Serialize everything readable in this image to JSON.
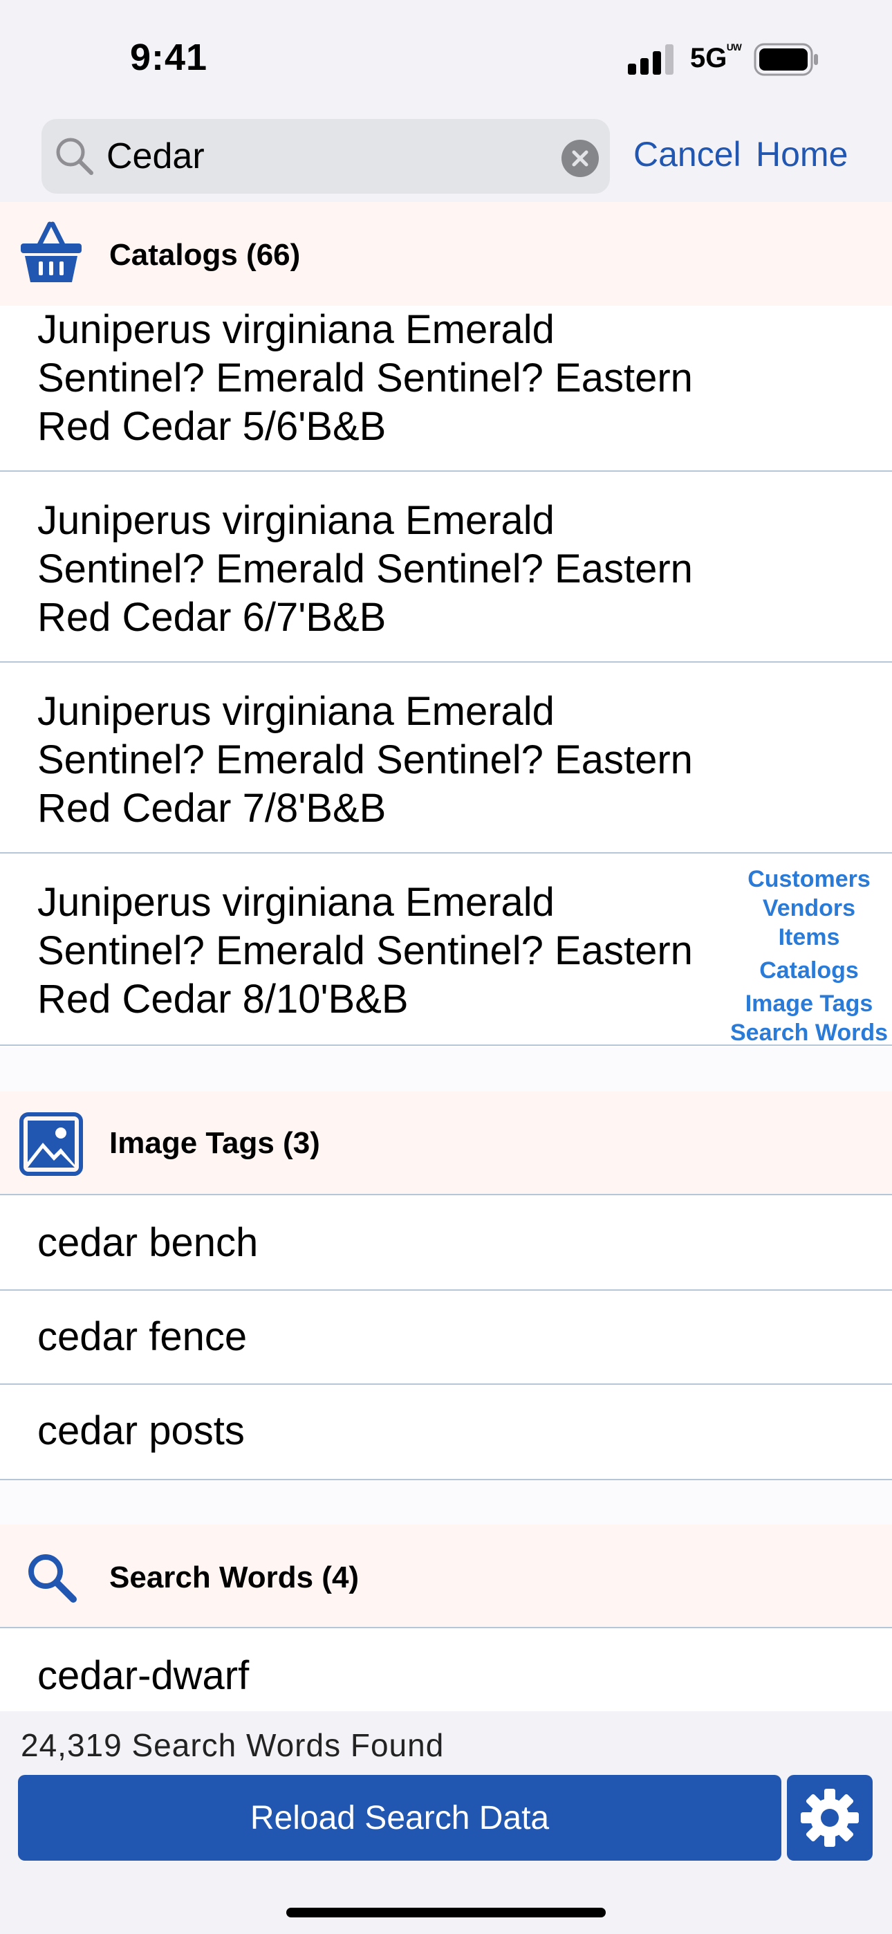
{
  "status_bar": {
    "time": "9:41",
    "network": "5G"
  },
  "search": {
    "value": "Cedar",
    "cancel_label": "Cancel",
    "home_label": "Home"
  },
  "sections": {
    "catalogs": {
      "title": "Catalogs (66)",
      "items": [
        "Juniperus virginiana Emerald Sentinel? Emerald Sentinel? Eastern Red Cedar 5/6'B&B",
        "Juniperus virginiana Emerald Sentinel? Emerald Sentinel? Eastern Red Cedar 6/7'B&B",
        "Juniperus virginiana Emerald Sentinel? Emerald Sentinel? Eastern Red Cedar 7/8'B&B",
        "Juniperus virginiana Emerald Sentinel? Emerald Sentinel? Eastern Red Cedar 8/10'B&B"
      ]
    },
    "image_tags": {
      "title": "Image Tags (3)",
      "items": [
        "cedar bench",
        "cedar fence",
        "cedar posts"
      ]
    },
    "search_words": {
      "title": "Search Words (4)",
      "items": [
        "cedar-dwarf"
      ]
    }
  },
  "section_index": [
    "Customers",
    "Vendors",
    "Items",
    "Catalogs",
    "Image Tags",
    "Search Words"
  ],
  "footer": {
    "found_label": "24,319 Search Words Found",
    "reload_label": "Reload Search Data"
  },
  "colors": {
    "accent": "#2157b0",
    "index_link": "#2a7bd8",
    "section_header_bg": "#fff6f3",
    "separator": "#b5c6d8"
  },
  "icons": {
    "catalogs": "basket-icon",
    "image_tags": "image-icon",
    "search_words": "magnifier-icon",
    "settings": "gear-icon"
  }
}
